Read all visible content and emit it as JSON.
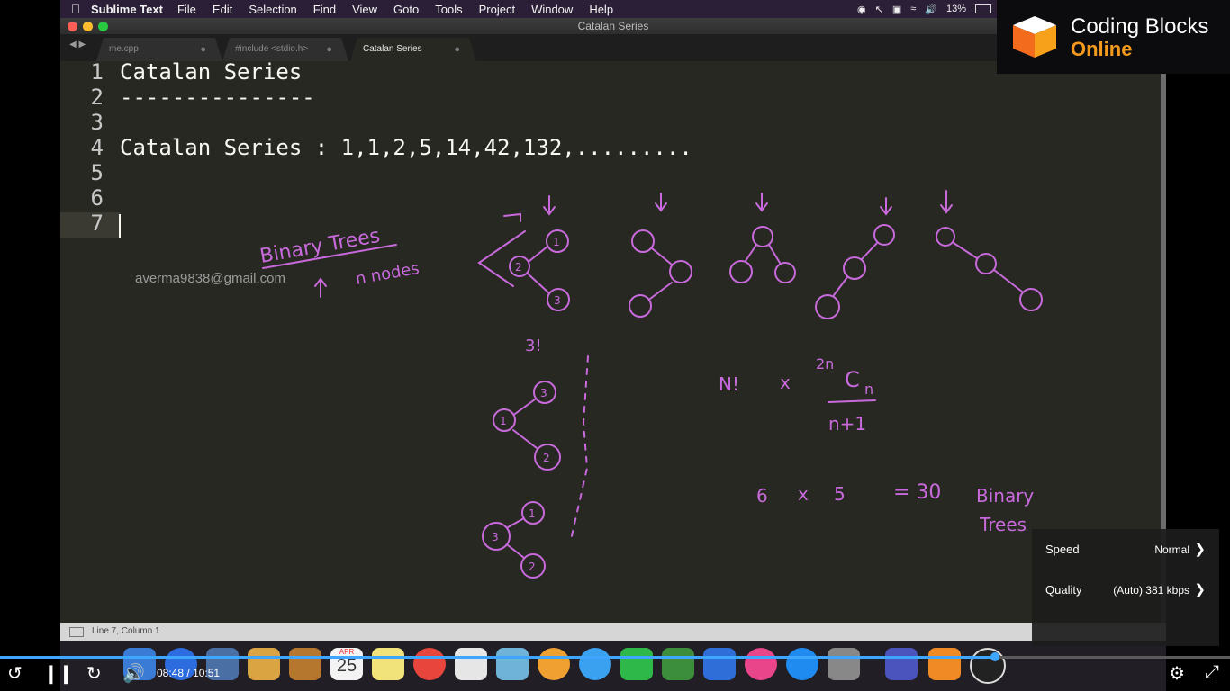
{
  "menubar": {
    "app": "Sublime Text",
    "items": [
      "File",
      "Edit",
      "Selection",
      "Find",
      "View",
      "Goto",
      "Tools",
      "Project",
      "Window",
      "Help"
    ],
    "battery": "13%"
  },
  "window": {
    "title": "Catalan Series"
  },
  "tabs": [
    {
      "label": "me.cpp"
    },
    {
      "label": "#include <stdio.h>"
    },
    {
      "label": "Catalan Series"
    }
  ],
  "editor": {
    "line_numbers": [
      "1",
      "2",
      "3",
      "4",
      "5",
      "6",
      "7"
    ],
    "lines": [
      "Catalan Series",
      "---------------",
      "",
      "Catalan Series : 1,1,2,5,14,42,132,.........",
      "",
      "",
      ""
    ]
  },
  "watermark_email": "averma9838@gmail.com",
  "status": {
    "position": "Line 7, Column 1"
  },
  "logo": {
    "line1": "Coding Blocks",
    "line2": "Online"
  },
  "player": {
    "current_time": "08:48",
    "separator": "/",
    "duration": "10:51",
    "progress": 0.811
  },
  "settings_menu": {
    "speed_label": "Speed",
    "speed_value": "Normal",
    "quality_label": "Quality",
    "quality_value": "(Auto) 381 kbps"
  },
  "dock": {
    "calendar_month": "APR",
    "calendar_day": "25"
  },
  "handwriting": {
    "binary_trees": "Binary Trees",
    "n_nodes": "n nodes",
    "three_factorial": "3!",
    "n_fact": "N!",
    "times": "x",
    "two_n": "2n",
    "c": "C",
    "n": "n",
    "n_plus_1": "n+1",
    "six": "6",
    "five": "5",
    "eq30": "= 30",
    "binary": "Binary",
    "trees": "Trees"
  },
  "colors": {
    "ink": "#c86adc",
    "accent": "#3ea6ff",
    "brand_orange": "#f39a1d"
  }
}
